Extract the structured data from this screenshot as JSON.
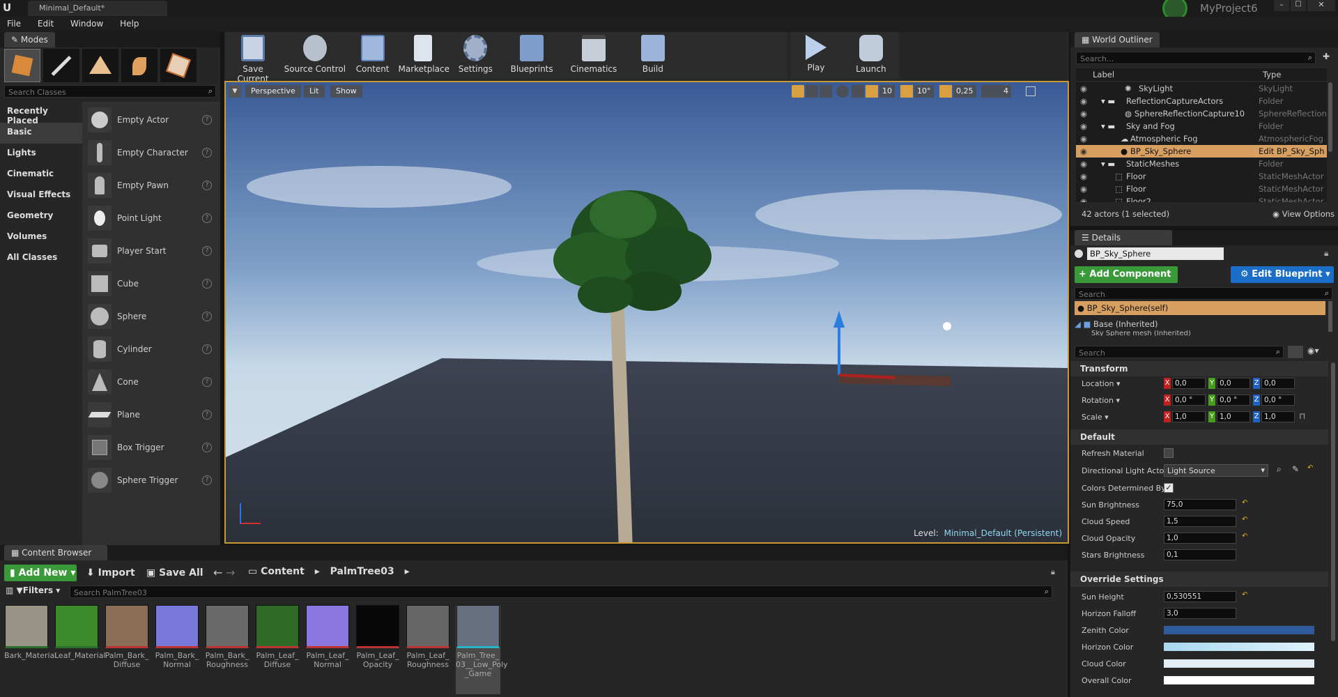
{
  "window": {
    "tab_title": "Minimal_Default*",
    "project": "MyProject6"
  },
  "menu": [
    "File",
    "Edit",
    "Window",
    "Help"
  ],
  "modes": {
    "tab": "Modes",
    "search_placeholder": "Search Classes",
    "categories": [
      "Recently Placed",
      "Basic",
      "Lights",
      "Cinematic",
      "Visual Effects",
      "Geometry",
      "Volumes",
      "All Classes"
    ],
    "items": [
      "Empty Actor",
      "Empty Character",
      "Empty Pawn",
      "Point Light",
      "Player Start",
      "Cube",
      "Sphere",
      "Cylinder",
      "Cone",
      "Plane",
      "Box Trigger",
      "Sphere Trigger"
    ]
  },
  "toolbar": [
    "Save Current",
    "Source Control",
    "Content",
    "Marketplace",
    "Settings",
    "Blueprints",
    "Cinematics",
    "Build",
    "Play",
    "Launch"
  ],
  "viewport": {
    "perspective": "Perspective",
    "lit": "Lit",
    "show": "Show",
    "grid_snap": "10",
    "rot_snap": "10°",
    "scale_snap": "0,25",
    "cam_speed": "4",
    "level_label": "Level:",
    "level_name": "Minimal_Default (Persistent)"
  },
  "outliner": {
    "tab": "World Outliner",
    "search_placeholder": "Search...",
    "col_label": "Label",
    "col_type": "Type",
    "rows": [
      {
        "label": "SkyLight",
        "type": "SkyLight"
      },
      {
        "label": "ReflectionCaptureActors",
        "type": "Folder"
      },
      {
        "label": "SphereReflectionCapture10",
        "type": "SphereReflectionC"
      },
      {
        "label": "Sky and Fog",
        "type": "Folder"
      },
      {
        "label": "Atmospheric Fog",
        "type": "AtmosphericFog"
      },
      {
        "label": "BP_Sky_Sphere",
        "type": "Edit BP_Sky_Sph"
      },
      {
        "label": "StaticMeshes",
        "type": "Folder"
      },
      {
        "label": "Floor",
        "type": "StaticMeshActor"
      },
      {
        "label": "Floor",
        "type": "StaticMeshActor"
      },
      {
        "label": "Floor2",
        "type": "StaticMeshActor"
      }
    ],
    "status": "42 actors (1 selected)",
    "view_options": "View Options"
  },
  "details": {
    "tab": "Details",
    "name": "BP_Sky_Sphere",
    "add_component": "+ Add Component",
    "edit_blueprint": "Edit Blueprint",
    "search_placeholder": "Search",
    "self_row": "BP_Sky_Sphere(self)",
    "base_row": "Base (Inherited)",
    "base_sub": "Sky Sphere mesh (Inherited)",
    "search2_placeholder": "Search",
    "transform": {
      "title": "Transform",
      "location_label": "Location",
      "rotation_label": "Rotation",
      "scale_label": "Scale",
      "location": [
        "0,0",
        "0,0",
        "0,0"
      ],
      "rotation": [
        "0,0 °",
        "0,0 °",
        "0,0 °"
      ],
      "scale": [
        "1,0",
        "1,0",
        "1,0"
      ]
    },
    "default": {
      "title": "Default",
      "refresh_material": "Refresh Material",
      "directional_light": "Directional Light Actor",
      "light_source": "Light Source",
      "colors_determined": "Colors Determined By",
      "sun_brightness_label": "Sun Brightness",
      "sun_brightness": "75,0",
      "cloud_speed_label": "Cloud Speed",
      "cloud_speed": "1,5",
      "cloud_opacity_label": "Cloud Opacity",
      "cloud_opacity": "1,0",
      "stars_brightness_label": "Stars Brightness",
      "stars_brightness": "0,1"
    },
    "override": {
      "title": "Override Settings",
      "sun_height_label": "Sun Height",
      "sun_height": "0,530551",
      "horizon_falloff_label": "Horizon Falloff",
      "horizon_falloff": "3,0",
      "zenith_color": "Zenith Color",
      "horizon_color": "Horizon Color",
      "cloud_color": "Cloud Color",
      "overall_color": "Overall Color",
      "zenith_hex": "#2f5b9a",
      "horizon_hex": "#a8d8f0",
      "cloud_hex": "#e4eef6",
      "overall_hex": "#ffffff"
    }
  },
  "content_browser": {
    "tab": "Content Browser",
    "add_new": "Add New",
    "import": "Import",
    "save_all": "Save All",
    "path": [
      "Content",
      "PalmTree03"
    ],
    "filters": "Filters",
    "search_placeholder": "Search PalmTree03",
    "assets": [
      {
        "name": "Bark_Material",
        "color": "#9a9486",
        "bar": "#2e6e2e"
      },
      {
        "name": "Leaf_Material",
        "color": "#3d8a2c",
        "bar": "#2e6e2e"
      },
      {
        "name": "Palm_Bark_\nDiffuse",
        "color": "#8a6e58",
        "bar": "#b33"
      },
      {
        "name": "Palm_Bark_\nNormal",
        "color": "#7878d8",
        "bar": "#b33"
      },
      {
        "name": "Palm_Bark_\nRoughness",
        "color": "#6a6a6a",
        "bar": "#b33"
      },
      {
        "name": "Palm_Leaf_\nDiffuse",
        "color": "#2f6a26",
        "bar": "#b33"
      },
      {
        "name": "Palm_Leaf_\nNormal",
        "color": "#8a78e0",
        "bar": "#b33"
      },
      {
        "name": "Palm_Leaf_\nOpacity",
        "color": "#080808",
        "bar": "#b33"
      },
      {
        "name": "Palm_Leaf_\nRoughness",
        "color": "#666",
        "bar": "#b33"
      },
      {
        "name": "Palm_Tree_\n03__Low_Poly\n_Game",
        "color": "#667080",
        "bar": "#2ab4c8"
      }
    ]
  }
}
